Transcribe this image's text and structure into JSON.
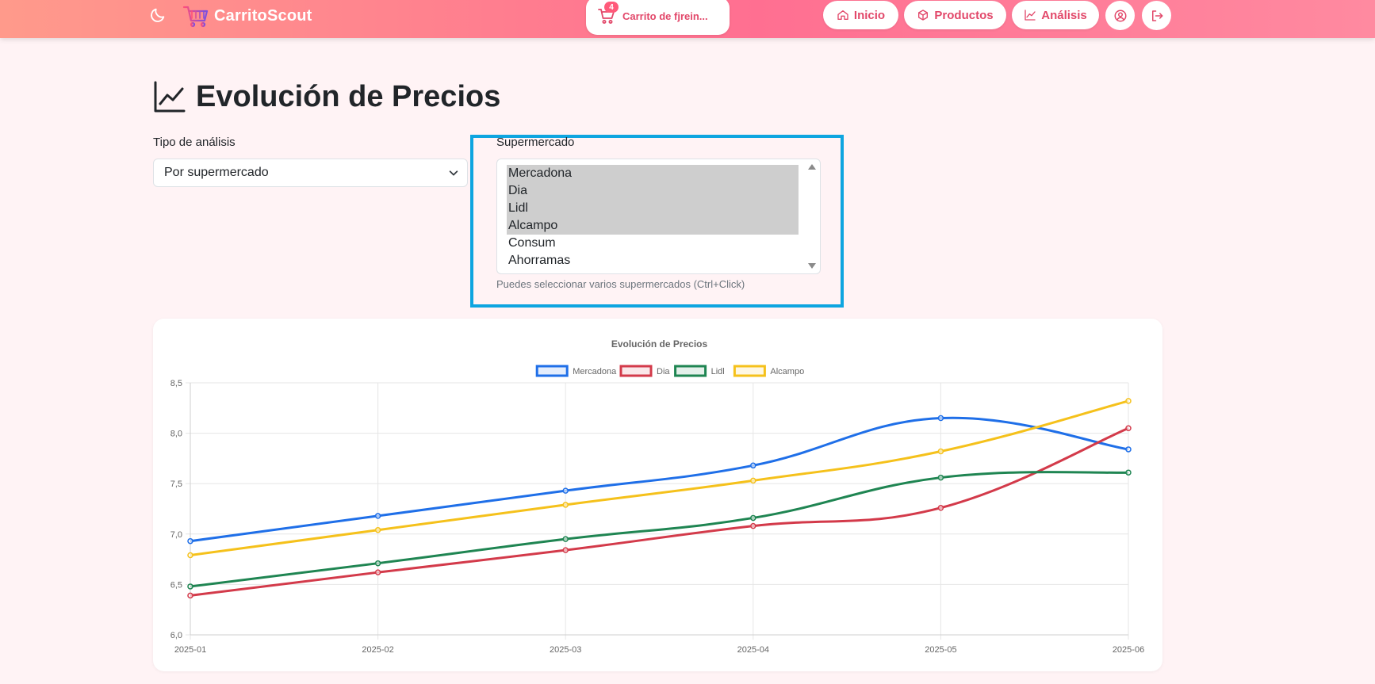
{
  "navbar": {
    "brand": "CarritoScout",
    "cart_count": "4",
    "cart_label": "Carrito de fjrein...",
    "links": [
      {
        "label": "Inicio",
        "icon": "home-icon"
      },
      {
        "label": "Productos",
        "icon": "box-icon"
      },
      {
        "label": "Análisis",
        "icon": "chart-line-icon"
      }
    ],
    "accent": "#e2486a"
  },
  "page": {
    "title": "Evolución de Precios"
  },
  "form": {
    "analysis_label": "Tipo de análisis",
    "analysis_value": "Por supermercado",
    "market_label": "Supermercado",
    "markets": [
      {
        "name": "Mercadona",
        "selected": true
      },
      {
        "name": "Dia",
        "selected": true
      },
      {
        "name": "Lidl",
        "selected": true
      },
      {
        "name": "Alcampo",
        "selected": true
      },
      {
        "name": "Consum",
        "selected": false
      },
      {
        "name": "Ahorramas",
        "selected": false
      }
    ],
    "help_text": "Puedes seleccionar varios supermercados (Ctrl+Click)"
  },
  "chart_data": {
    "type": "line",
    "title": "Evolución de Precios",
    "x": [
      "2025-01",
      "2025-02",
      "2025-03",
      "2025-04",
      "2025-05",
      "2025-06"
    ],
    "ylim": [
      6.0,
      8.5
    ],
    "yticks": [
      "6,0",
      "6,5",
      "7,0",
      "7,5",
      "8,0",
      "8,5"
    ],
    "grid": true,
    "legend_position": "top",
    "series": [
      {
        "name": "Mercadona",
        "color": "#1f6fe8",
        "values": [
          6.93,
          7.18,
          7.43,
          7.68,
          8.15,
          7.84
        ]
      },
      {
        "name": "Dia",
        "color": "#d33a4a",
        "values": [
          6.39,
          6.62,
          6.84,
          7.08,
          7.26,
          8.05
        ]
      },
      {
        "name": "Lidl",
        "color": "#1f8552",
        "values": [
          6.48,
          6.71,
          6.95,
          7.16,
          7.56,
          7.61
        ]
      },
      {
        "name": "Alcampo",
        "color": "#f5c11b",
        "values": [
          6.79,
          7.04,
          7.29,
          7.53,
          7.82,
          8.32
        ]
      }
    ]
  }
}
